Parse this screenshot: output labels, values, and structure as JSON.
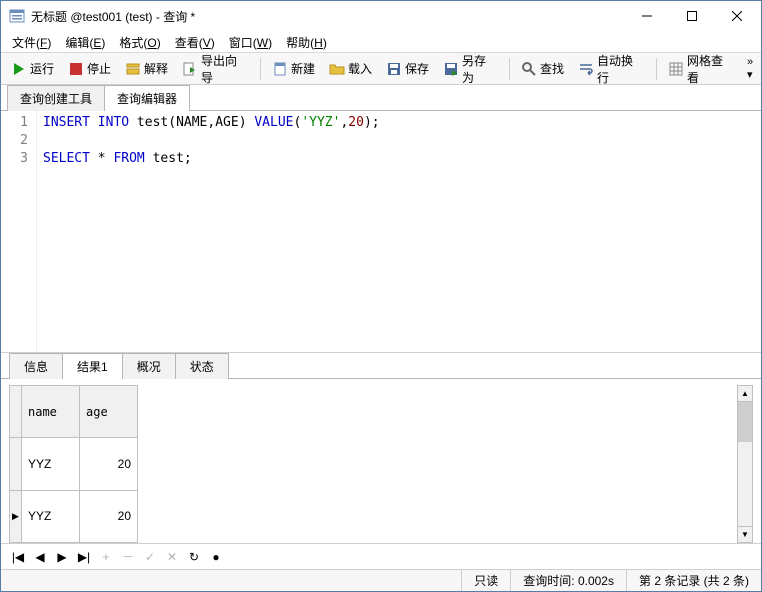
{
  "window": {
    "title": "无标题 @test001 (test) - 查询 *"
  },
  "menu": {
    "file": "文件",
    "file_k": "F",
    "edit": "编辑",
    "edit_k": "E",
    "format": "格式",
    "format_k": "O",
    "view": "查看",
    "view_k": "V",
    "window": "窗口",
    "window_k": "W",
    "help": "帮助",
    "help_k": "H"
  },
  "toolbar": {
    "run": "运行",
    "stop": "停止",
    "explain": "解释",
    "export": "导出向导",
    "new": "新建",
    "load": "载入",
    "save": "保存",
    "saveas": "另存为",
    "find": "查找",
    "wrap": "自动换行",
    "gridview": "网格查看"
  },
  "upper_tabs": {
    "builder": "查询创建工具",
    "editor": "查询编辑器"
  },
  "code": {
    "lines": [
      "1",
      "2",
      "3"
    ],
    "l1_kw1": "INSERT",
    "l1_kw2": "INTO",
    "l1_id": " test",
    "l1_paren": "(NAME,AGE) ",
    "l1_kw3": "VALUE",
    "l1_open": "(",
    "l1_str": "'YYZ'",
    "l1_comma": ",",
    "l1_num": "20",
    "l1_close": ");",
    "l3_kw1": "SELECT",
    "l3_star": " * ",
    "l3_kw2": "FROM",
    "l3_id": " test",
    "l3_end": ";"
  },
  "lower_tabs": {
    "info": "信息",
    "result": "结果1",
    "profile": "概况",
    "status": "状态"
  },
  "grid": {
    "headers": {
      "name": "name",
      "age": "age"
    },
    "rows": [
      {
        "mark": "",
        "name": "YYZ",
        "age": "20"
      },
      {
        "mark": "▶",
        "name": "YYZ",
        "age": "20"
      }
    ]
  },
  "nav": {
    "first": "|◀",
    "prev": "◀",
    "next": "▶",
    "last": "▶|",
    "plus": "+",
    "minus": "－",
    "check": "✓",
    "x": "✕",
    "refresh": "↻",
    "o": "●"
  },
  "status": {
    "readonly": "只读",
    "qtime": "查询时间: 0.002s",
    "rec": "第 2 条记录 (共 2 条)"
  }
}
